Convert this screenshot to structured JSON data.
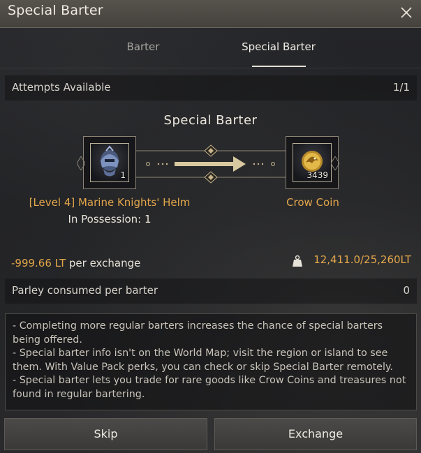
{
  "window": {
    "title": "Special Barter"
  },
  "tabs": [
    {
      "label": "Barter",
      "active": false
    },
    {
      "label": "Special Barter",
      "active": true
    }
  ],
  "attempts": {
    "label": "Attempts Available",
    "value": "1/1"
  },
  "exchange": {
    "heading": "Special Barter",
    "give_item": {
      "name": "[Level 4] Marine Knights' Helm",
      "quantity": "1",
      "possession": "In Possession: 1",
      "icon": "helm-icon"
    },
    "receive_item": {
      "name": "Crow Coin",
      "quantity": "3439",
      "icon": "coin-icon"
    }
  },
  "weight": {
    "per_exchange_value": "-999.66 LT",
    "per_exchange_suffix": " per exchange",
    "capacity": "12,411.0/25,260LT"
  },
  "parley": {
    "label": "Parley consumed per barter",
    "value": "0"
  },
  "info_lines": [
    "- Completing more regular barters increases the chance of special barters being offered.",
    "- Special barter info isn't on the World Map; visit the region or island to see them. With Value Pack perks, you can check or skip Special Barter remotely.",
    "- Special barter lets you trade for rare goods like Crow Coins and treasures not found in regular bartering."
  ],
  "buttons": {
    "skip": "Skip",
    "exchange": "Exchange"
  },
  "colors": {
    "accent_orange": "#e3a64a",
    "gold": "#c8b48a"
  }
}
